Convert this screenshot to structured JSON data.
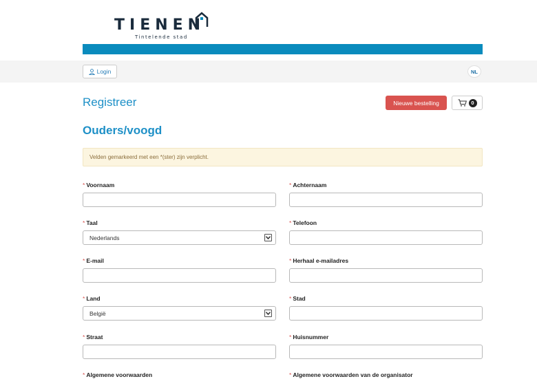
{
  "brand": {
    "logo_text": "TIENEN",
    "logo_sub": "Tintelende stad"
  },
  "topbar": {
    "login_label": "Login",
    "language": "NL"
  },
  "header": {
    "title": "Registreer",
    "new_order_label": "Nieuwe bestelling",
    "cart_count": "0"
  },
  "section": {
    "title": "Ouders/voogd"
  },
  "notice": "Velden gemarkeerd met een *(ster) zijn verplicht.",
  "form": {
    "required_mark": "*",
    "fields": {
      "voornaam": {
        "label": "Voornaam",
        "value": ""
      },
      "achternaam": {
        "label": "Achternaam",
        "value": ""
      },
      "taal": {
        "label": "Taal",
        "value": "Nederlands"
      },
      "telefoon": {
        "label": "Telefoon",
        "value": ""
      },
      "email": {
        "label": "E-mail",
        "value": ""
      },
      "email_repeat": {
        "label": "Herhaal e-mailadres",
        "value": ""
      },
      "land": {
        "label": "Land",
        "value": "België"
      },
      "stad": {
        "label": "Stad",
        "value": ""
      },
      "straat": {
        "label": "Straat",
        "value": ""
      },
      "huisnummer": {
        "label": "Huisnummer",
        "value": ""
      },
      "voorwaarden": {
        "label": "Algemene voorwaarden"
      },
      "voorwaarden_org": {
        "label": "Algemene voorwaarden van de organisator"
      }
    }
  },
  "colors": {
    "accent": "#1e90c7",
    "bar": "#0a8bbd",
    "danger": "#d9534f",
    "notice_bg": "#fcf5e0"
  },
  "icons": {
    "login": "user-icon",
    "cart": "cart-icon",
    "select": "chevron-down-icon",
    "logo": "house-icon"
  }
}
